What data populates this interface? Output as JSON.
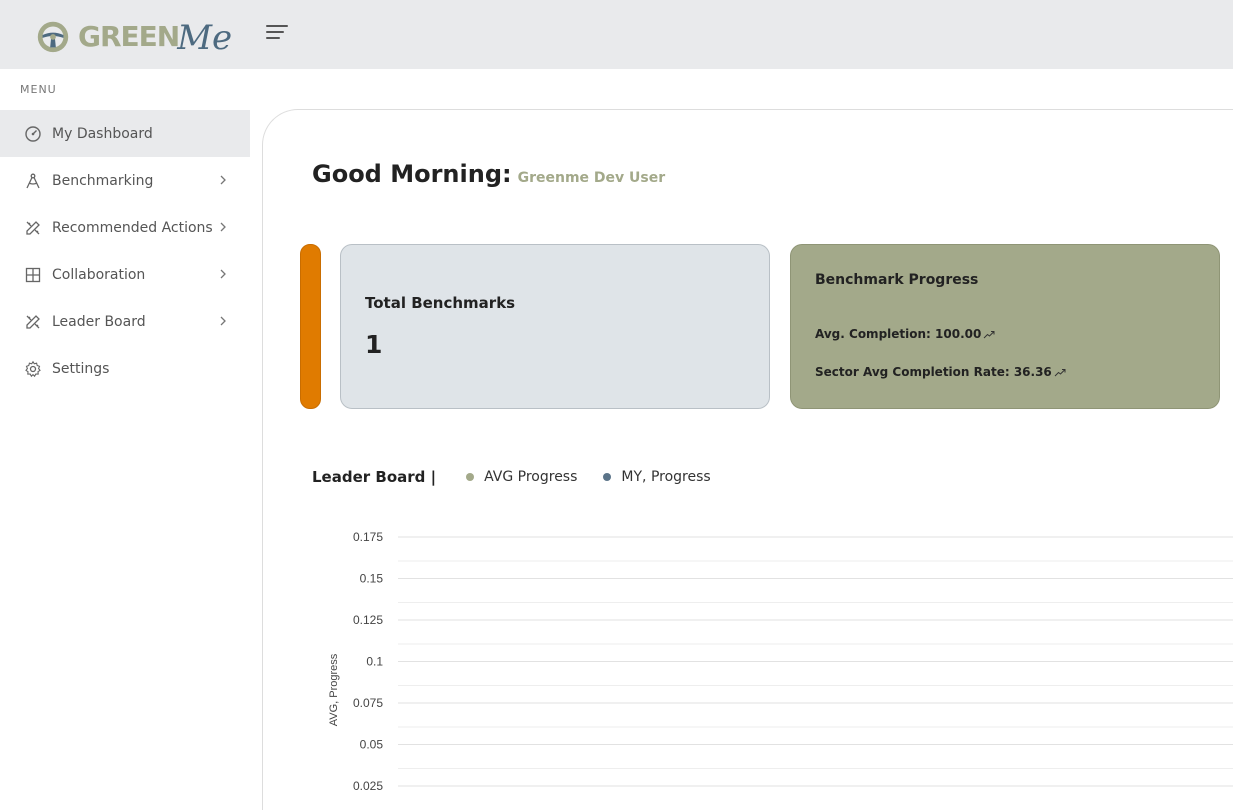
{
  "header": {
    "logo_text": "GREEN",
    "logo_script": "Me",
    "logo_badge_text": "GREENME"
  },
  "sidebar": {
    "menu_label": "MENU",
    "items": [
      {
        "label": "My Dashboard",
        "icon": "dashboard-gauge-icon",
        "active": true
      },
      {
        "label": "Benchmarking",
        "icon": "compass-icon",
        "chevron": true
      },
      {
        "label": "Recommended Actions",
        "icon": "pencil-ruler-icon",
        "chevron": true
      },
      {
        "label": "Collaboration",
        "icon": "grid-icon",
        "chevron": true
      },
      {
        "label": "Leader Board",
        "icon": "pencil-ruler-icon",
        "chevron": true
      },
      {
        "label": "Settings",
        "icon": "gear-icon"
      }
    ]
  },
  "main": {
    "greeting_label": "Good Morning:",
    "greeting_user": "Greenme Dev User",
    "total_benchmarks": {
      "title": "Total Benchmarks",
      "value": "1"
    },
    "benchmark_progress": {
      "title": "Benchmark Progress",
      "avg_completion": "Avg. Completion: 100.00",
      "sector_avg": "Sector Avg Completion Rate: 36.36"
    },
    "leader_board": {
      "title": "Leader Board |",
      "legend": [
        {
          "label": "AVG Progress",
          "color": "#a3a98a"
        },
        {
          "label": "MY, Progress",
          "color": "#5b7489"
        }
      ]
    }
  },
  "colors": {
    "accent_olive": "#a3a98a",
    "accent_blue": "#5b7489",
    "accent_orange": "#e07b00"
  },
  "chart_data": {
    "type": "line",
    "ylabel": "AVG, Progress",
    "yticks": [
      "0.175",
      "0.15",
      "0.125",
      "0.1",
      "0.075",
      "0.05",
      "0.025"
    ],
    "ylim": [
      0.025,
      0.175
    ],
    "grid": true,
    "legend_placement": "top-left",
    "series": [
      {
        "name": "AVG Progress",
        "values": []
      },
      {
        "name": "MY, Progress",
        "values": []
      }
    ]
  }
}
